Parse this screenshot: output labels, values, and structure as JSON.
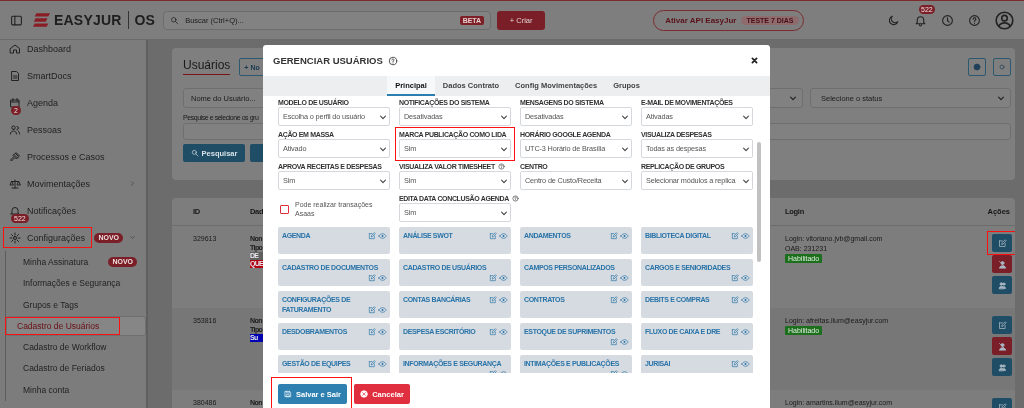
{
  "topbar": {
    "brand": "EASYJUR",
    "suffix": "OS",
    "search": {
      "placeholder": "Buscar (Ctrl+Q)...",
      "badge": "BETA"
    },
    "create_button": "+ Criar",
    "api_button": {
      "label": "Ativar API EasyJur",
      "badge": "TESTE 7 DIAS"
    },
    "notification_count": "522"
  },
  "sidebar": {
    "items": [
      {
        "label": "Dashboard",
        "highlighted": false
      },
      {
        "label": "SmartDocs",
        "highlighted": false
      },
      {
        "label": "Agenda",
        "count": "2",
        "highlighted": false
      },
      {
        "label": "Pessoas",
        "highlighted": false
      },
      {
        "label": "Processos e Casos",
        "highlighted": false
      },
      {
        "label": "Movimentações",
        "expanded": false,
        "highlighted": false
      },
      {
        "label": "Notificações",
        "count": "522",
        "highlighted": false
      },
      {
        "label": "Configurações",
        "tag": "NOVO",
        "expanded": true,
        "highlighted": true,
        "children": [
          {
            "label": "Minha Assinatura",
            "tag": "NOVO",
            "selected": false,
            "highlighted": false
          },
          {
            "label": "Informações e Segurança",
            "selected": false,
            "highlighted": false
          },
          {
            "label": "Grupos e Tags",
            "selected": false,
            "highlighted": false
          },
          {
            "label": "Cadastro de Usuários",
            "selected": true,
            "highlighted": true
          },
          {
            "label": "Cadastro de Workflow",
            "selected": false,
            "highlighted": false
          },
          {
            "label": "Cadastro de Feriados",
            "selected": false,
            "highlighted": false
          },
          {
            "label": "Minha conta",
            "selected": false,
            "highlighted": false
          }
        ]
      }
    ]
  },
  "page": {
    "title": "Usuários",
    "new_button": "+ No",
    "name_filter": {
      "placeholder": "Nome do Usuário..."
    },
    "group_label": "Pesquise e selecione os gru",
    "search_button": "Pesquisar",
    "status_filter": {
      "placeholder": "Selecione o status"
    }
  },
  "table": {
    "columns": [
      "ID",
      "Dad",
      "Login",
      "Ações"
    ],
    "rows": [
      {
        "id": "329613",
        "details": [
          "Non",
          "Tipo"
        ],
        "tags": [
          {
            "text": "DE",
            "color": "#5f5f5f"
          },
          {
            "text": "QUE",
            "color": "#b00010"
          }
        ],
        "login": [
          "Login: vitoriano.jvb@gmail.com",
          "OAB: 231231"
        ],
        "status": "Habilitado",
        "edit_highlighted": true
      },
      {
        "id": "353816",
        "details": [
          "Non",
          "Tipo"
        ],
        "tags": [
          {
            "text": "Su",
            "color": "#0000b0"
          }
        ],
        "login": [
          "Login: afreitas.ilum@easyjur.com"
        ],
        "status": "Habilitado",
        "edit_highlighted": false
      },
      {
        "id": "380486",
        "details": [
          "Non"
        ],
        "login": [
          "Login: amartins.ilum@easyjur.com"
        ],
        "edit_highlighted": false
      }
    ]
  },
  "modal": {
    "title": "GERENCIAR USUÁRIOS",
    "tabs": [
      {
        "label": "Principal",
        "selected": true
      },
      {
        "label": "Dados Contrato",
        "selected": false
      },
      {
        "label": "Config Movimentações",
        "selected": false
      },
      {
        "label": "Grupos",
        "selected": false
      }
    ],
    "fields": [
      {
        "kind": "select",
        "label": "MODELO DE USUÁRIO",
        "value": "Escolha o perfil do usuário",
        "help": false,
        "highlighted": false
      },
      {
        "kind": "select",
        "label": "NOTIFICAÇÕES DO SISTEMA",
        "value": "Desativadas",
        "help": false,
        "highlighted": false
      },
      {
        "kind": "select",
        "label": "MENSAGENS DO SISTEMA",
        "value": "Desativadas",
        "help": false,
        "highlighted": false
      },
      {
        "kind": "select",
        "label": "E-MAIL DE MOVIMENTAÇÕES",
        "value": "Ativadas",
        "help": false,
        "highlighted": false
      },
      {
        "kind": "select",
        "label": "AÇÃO EM MASSA",
        "value": "Ativado",
        "help": false,
        "highlighted": false
      },
      {
        "kind": "select",
        "label": "MARCA PUBLICAÇÃO COMO LIDA",
        "value": "Sim",
        "help": false,
        "highlighted": true
      },
      {
        "kind": "select",
        "label": "HORÁRIO GOOGLE AGENDA",
        "value": "UTC-3 Horário de Brasília",
        "help": false,
        "highlighted": false
      },
      {
        "kind": "select",
        "label": "VISUALIZA DESPESAS",
        "value": "Todas as despesas",
        "help": false,
        "highlighted": false
      },
      {
        "kind": "select",
        "label": "APROVA RECEITAS E DESPESAS",
        "value": "Sim",
        "help": false,
        "highlighted": false
      },
      {
        "kind": "select",
        "label": "VISUALIZA VALOR TIMESHEET",
        "value": "Sim",
        "help": true,
        "highlighted": false
      },
      {
        "kind": "select",
        "label": "CENTRO",
        "value": "Centro de Custo/Receita",
        "help": false,
        "highlighted": false
      },
      {
        "kind": "select",
        "label": "REPLICAÇÃO DE GRUPOS",
        "value": "Selecionar módulos a replica",
        "help": false,
        "highlighted": false
      },
      {
        "kind": "checkbox",
        "label": "Pode realizar transações Asaas",
        "checked": false,
        "highlighted": false
      },
      {
        "kind": "select",
        "label": "EDITA DATA CONCLUSÃO AGENDA",
        "value": "Sim",
        "help": true,
        "highlighted": false
      }
    ],
    "permissions": [
      "AGENDA",
      "ANÁLISE SWOT",
      "ANDAMENTOS",
      "BIBLIOTECA DIGITAL",
      "CADASTRO DE DOCUMENTOS",
      "CADASTRO DE USUÁRIOS",
      "CAMPOS PERSONALIZADOS",
      "CARGOS E SENIORIDADES",
      "CONFIGURAÇÕES DE FATURAMENTO",
      "CONTAS BANCÁRIAS",
      "CONTRATOS",
      "DEBITS E COMPRAS",
      "DESDOBRAMENTOS",
      "DESPESA ESCRITÓRIO",
      "ESTOQUE DE SUPRIMENTOS",
      "FLUXO DE CAIXA E DRE",
      "GESTÃO DE EQUIPES",
      "INFORMAÇÕES E SEGURANÇA",
      "INTIMAÇÕES E PUBLICAÇÕES",
      "JURISAI"
    ],
    "buttons": [
      {
        "label": "Salvar e Sair",
        "kind": "primary",
        "highlighted": true
      },
      {
        "label": "Cancelar",
        "kind": "danger",
        "highlighted": false
      }
    ]
  }
}
